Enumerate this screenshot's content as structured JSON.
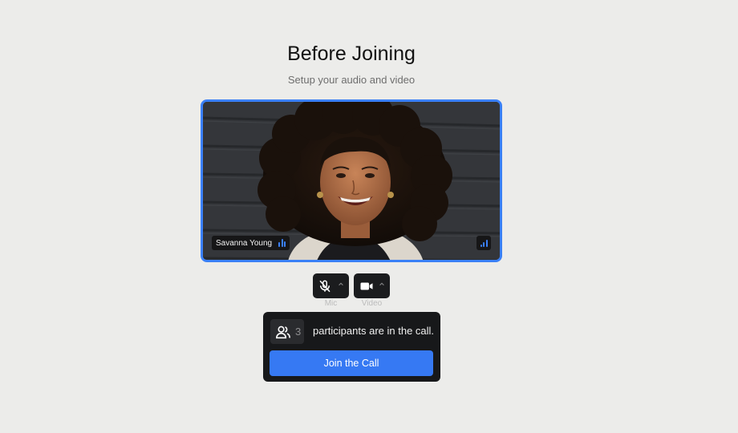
{
  "header": {
    "title": "Before Joining",
    "subtitle": "Setup your audio and video"
  },
  "preview": {
    "participant_name": "Savanna Young",
    "audio_level_icon": "audio-level-icon",
    "network_icon": "signal-strength-icon"
  },
  "controls": {
    "mic": {
      "label": "Mic",
      "icon": "mic-off-icon",
      "state": "muted"
    },
    "video": {
      "label": "Video",
      "icon": "video-camera-icon",
      "state": "on"
    }
  },
  "join_card": {
    "participant_count": "3",
    "participants_text": "participants are in the call.",
    "join_label": "Join the Call",
    "participants_icon": "users-icon"
  },
  "colors": {
    "accent": "#3a80f6",
    "background": "#ececea",
    "card": "#17181a"
  }
}
